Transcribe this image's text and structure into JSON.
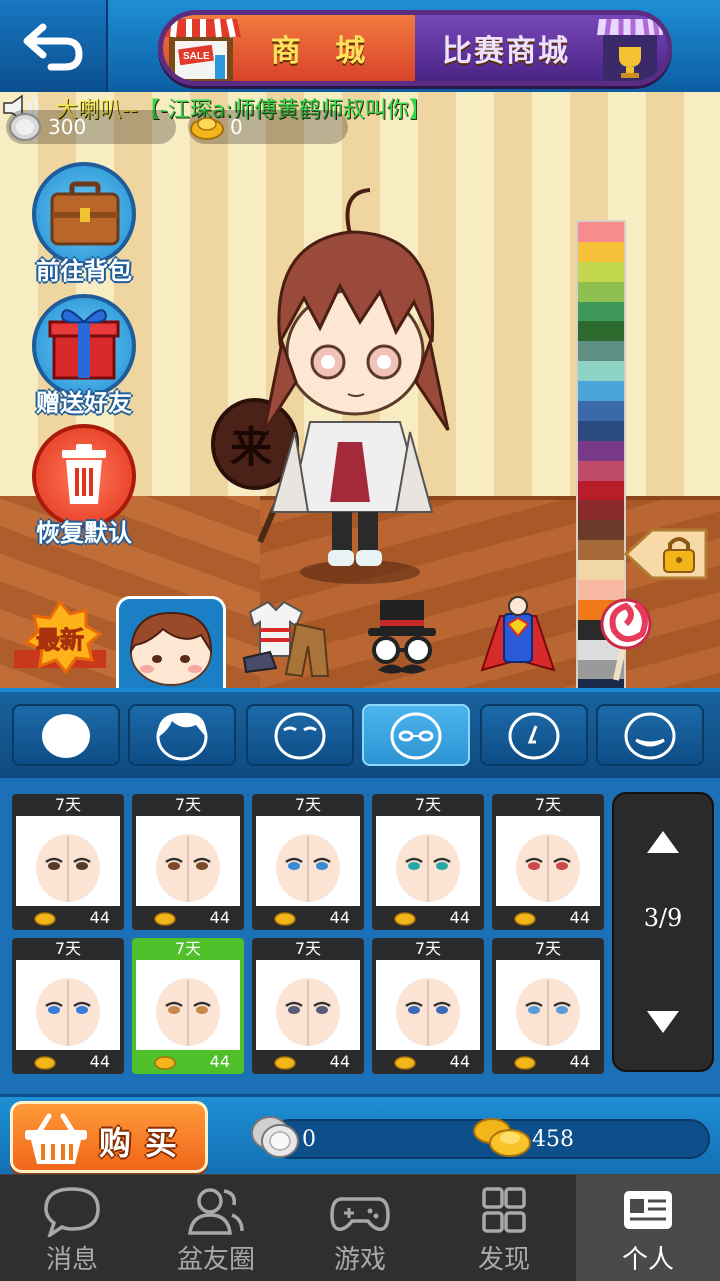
{
  "header": {
    "back_icon": "back-arrow-icon",
    "shop_label": "商 城",
    "match_shop_label": "比赛商城"
  },
  "ticker": {
    "speaker": "大喇叭--",
    "message": "【-江琛a:师傅黄鹤师叔叫你】"
  },
  "currency": {
    "silver": "300",
    "gold": "0"
  },
  "side_buttons": [
    {
      "label": "前往背包",
      "icon": "briefcase-icon"
    },
    {
      "label": "赠送好友",
      "icon": "gift-icon"
    },
    {
      "label": "恢复默认",
      "icon": "trash-icon"
    }
  ],
  "palette": {
    "colors": [
      "#f78c8c",
      "#f6c23a",
      "#c4d84e",
      "#8fbf4f",
      "#3f9a5a",
      "#2d6a2d",
      "#5f8f82",
      "#8fd3c4",
      "#4aa6d8",
      "#3a6aa8",
      "#2a4a80",
      "#7a3a8a",
      "#c04a6a",
      "#b81e2a",
      "#8a2a2a",
      "#6a3a2a",
      "#a66a3a",
      "#f2d7a6",
      "#f6b8a0",
      "#f07a1a",
      "#2a2a2a",
      "#dcdcdc",
      "#9a9a9a",
      "#1a2a4a"
    ],
    "lock_icon": "lock-icon"
  },
  "categories": [
    {
      "label": "最新",
      "icon": "new-badge-icon"
    },
    {
      "label": "",
      "icon": "face-category-icon"
    },
    {
      "label": "",
      "icon": "clothes-icon"
    },
    {
      "label": "",
      "icon": "hat-glasses-icon"
    },
    {
      "label": "",
      "icon": "costume-icon"
    },
    {
      "label": "",
      "icon": "lollipop-icon"
    }
  ],
  "sub_categories": [
    "head-shape-icon",
    "hair-icon",
    "eyebrows-icon",
    "eyes-icon",
    "nose-icon",
    "mouth-icon"
  ],
  "items": [
    {
      "days": "7天",
      "price": "44"
    },
    {
      "days": "7天",
      "price": "44"
    },
    {
      "days": "7天",
      "price": "44"
    },
    {
      "days": "7天",
      "price": "44"
    },
    {
      "days": "7天",
      "price": "44"
    },
    {
      "days": "7天",
      "price": "44"
    },
    {
      "days": "7天",
      "price": "44"
    },
    {
      "days": "7天",
      "price": "44"
    },
    {
      "days": "7天",
      "price": "44"
    },
    {
      "days": "7天",
      "price": "44"
    }
  ],
  "pager": {
    "text": "3/9"
  },
  "buy": {
    "label": "购买",
    "silver_balance": "0",
    "gold_balance": "458"
  },
  "bottom_nav": [
    {
      "label": "消息",
      "icon": "chat-bubble-icon"
    },
    {
      "label": "盆友圈",
      "icon": "friends-icon"
    },
    {
      "label": "游戏",
      "icon": "gamepad-icon"
    },
    {
      "label": "发现",
      "icon": "grid-icon"
    },
    {
      "label": "个人",
      "icon": "id-card-icon"
    }
  ]
}
